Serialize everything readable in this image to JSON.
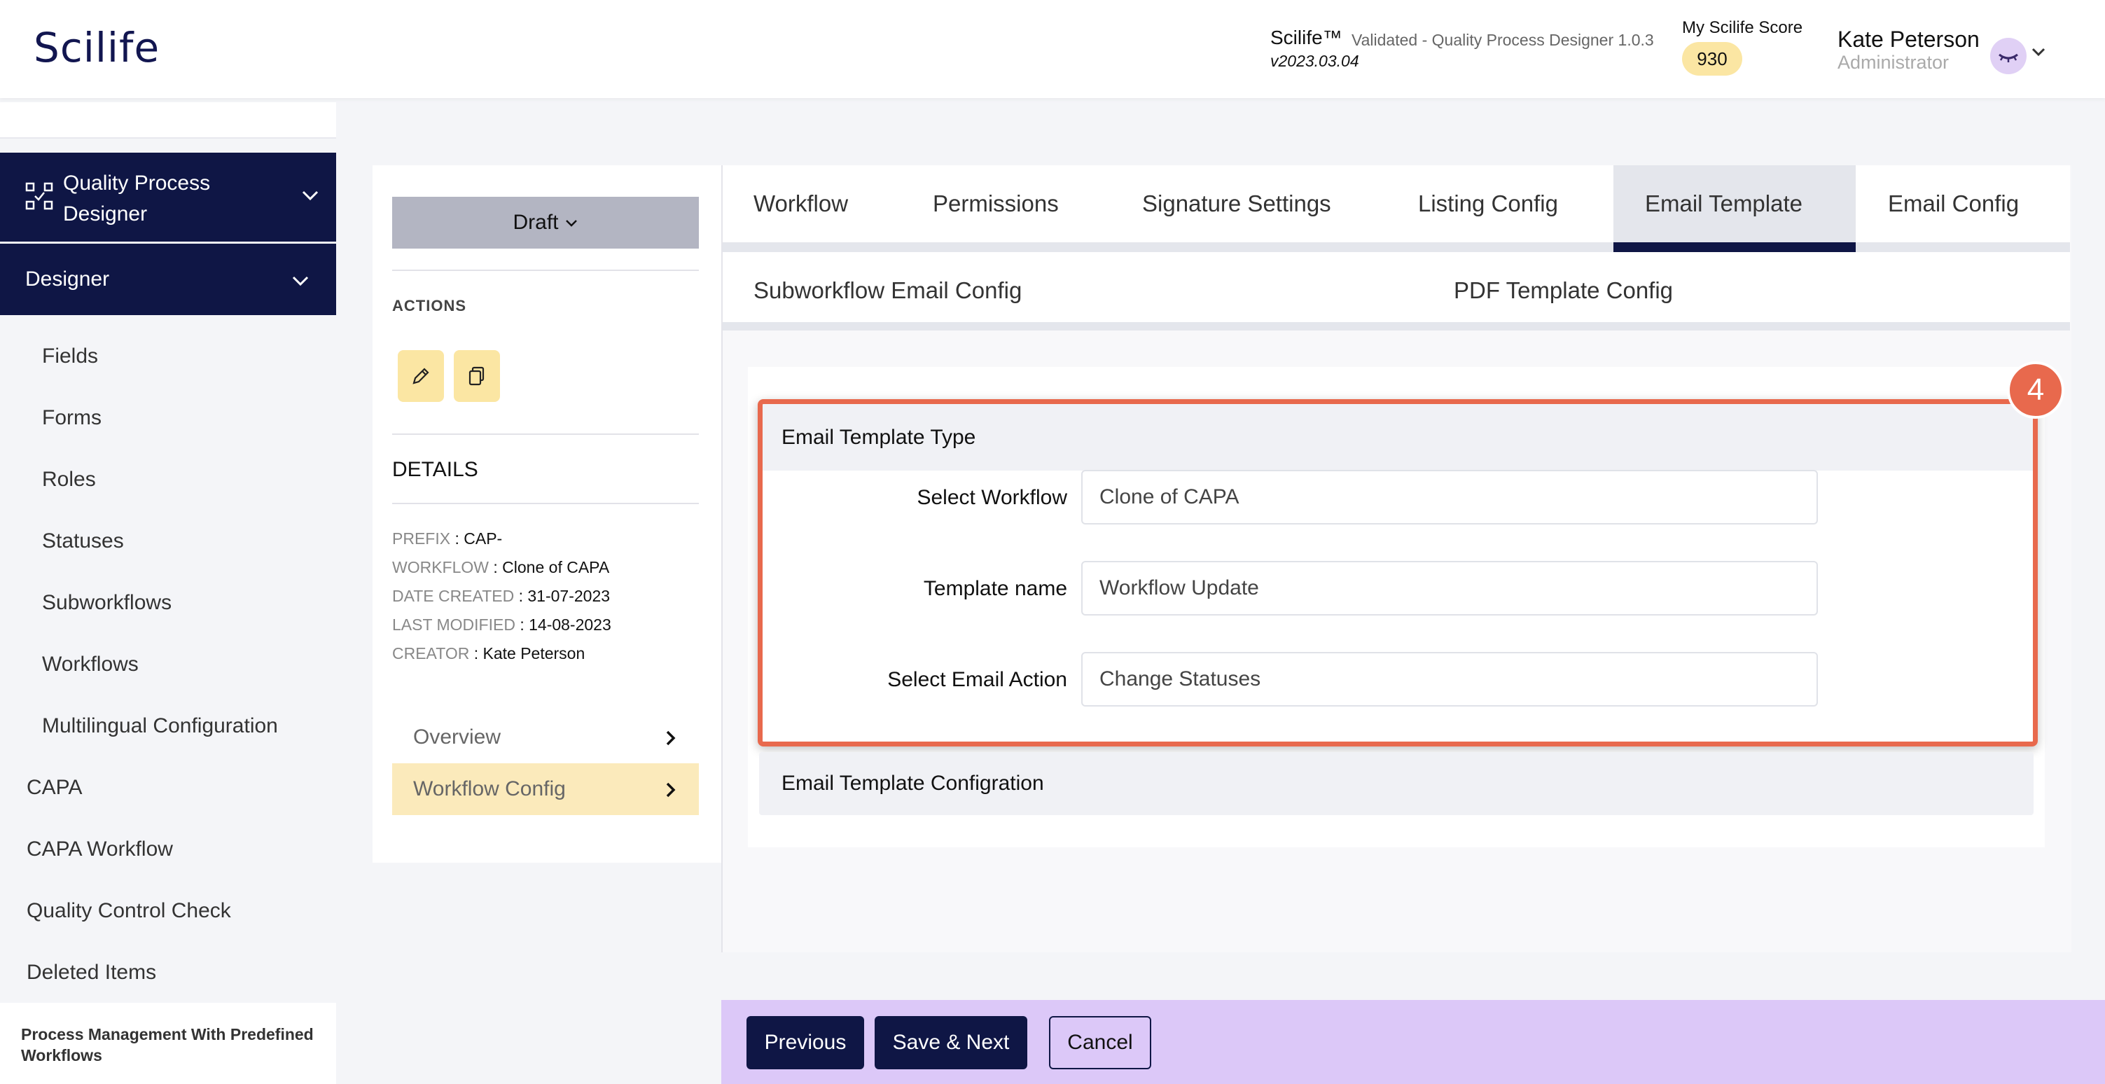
{
  "header": {
    "logo": "Scilife",
    "app_name": "Scilife™",
    "app_validated": "Validated - Quality Process Designer 1.0.3",
    "app_version": "v2023.03.04",
    "score_label": "My Scilife Score",
    "score_value": "930",
    "user_name": "Kate Peterson",
    "user_role": "Administrator"
  },
  "sidebar": {
    "module": "Quality Process Designer",
    "section": "Designer",
    "sub_items": [
      "Fields",
      "Forms",
      "Roles",
      "Statuses",
      "Subworkflows",
      "Workflows",
      "Multilingual Configuration"
    ],
    "top_items": [
      "CAPA",
      "CAPA Workflow",
      "Quality Control Check",
      "Deleted Items"
    ],
    "footer": "Process Management With Predefined Workflows"
  },
  "left_card": {
    "status": "Draft",
    "actions_label": "ACTIONS",
    "details_title": "DETAILS",
    "details": [
      {
        "key": "PREFIX",
        "value": "CAP-"
      },
      {
        "key": "WORKFLOW",
        "value": "Clone of CAPA"
      },
      {
        "key": "DATE CREATED",
        "value": "31-07-2023"
      },
      {
        "key": "LAST MODIFIED",
        "value": "14-08-2023"
      },
      {
        "key": "CREATOR",
        "value": "Kate Peterson"
      }
    ],
    "nav": [
      {
        "label": "Overview"
      },
      {
        "label": "Workflow Config"
      }
    ]
  },
  "tabs": [
    "Workflow",
    "Permissions",
    "Signature Settings",
    "Listing Config",
    "Email Template",
    "Email Config"
  ],
  "active_tab": "Email Template",
  "subtabs": [
    "Subworkflow Email Config",
    "PDF Template Config"
  ],
  "email_type": {
    "title": "Email Template Type",
    "fields": [
      {
        "label": "Select Workflow",
        "value": "Clone of CAPA"
      },
      {
        "label": "Template name",
        "value": "Workflow Update"
      },
      {
        "label": "Select Email Action",
        "value": "Change Statuses"
      }
    ]
  },
  "step_badge": "4",
  "config_title": "Email Template Configration",
  "footer_buttons": {
    "previous": "Previous",
    "save_next": "Save & Next",
    "cancel": "Cancel"
  },
  "colors": {
    "navy": "#0f1645",
    "highlight": "#e8694d",
    "score_bg": "#fbe6a3",
    "bottom_bar": "#dcc8f8"
  }
}
